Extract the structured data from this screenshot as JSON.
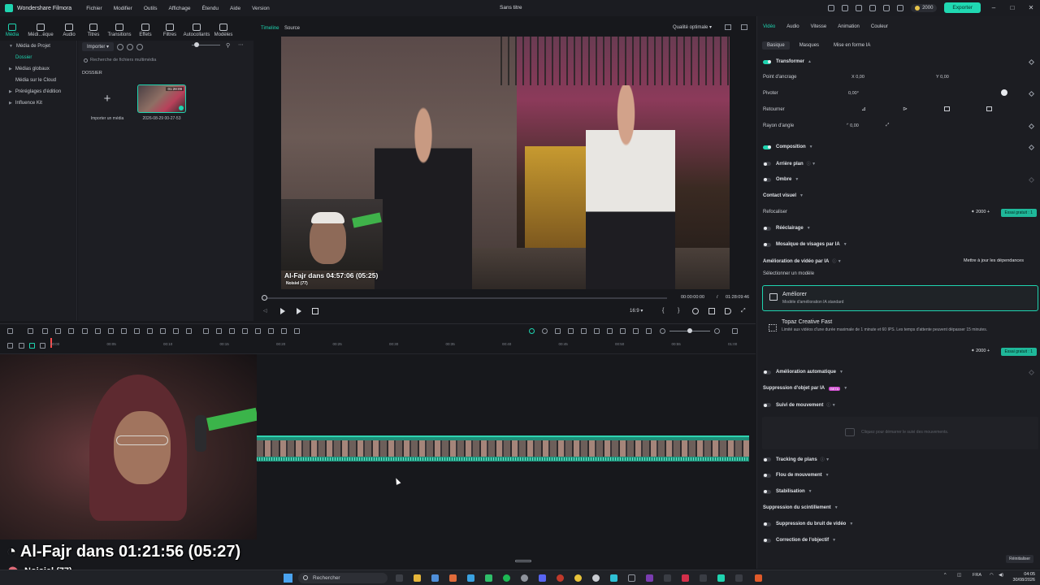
{
  "app": {
    "name": "Wondershare Filmora",
    "project_title": "Sans titre",
    "menu": [
      "Fichier",
      "Modifier",
      "Outils",
      "Affichage",
      "Étendu",
      "Aide",
      "Version"
    ],
    "credits": "2000",
    "export_label": "Exporter"
  },
  "media_tabs": [
    "Média",
    "Médi...èque",
    "Audio",
    "Titres",
    "Transitions",
    "Effets",
    "Filtres",
    "Autocollants",
    "Modèles"
  ],
  "left_nav": {
    "items": [
      {
        "label": "Média de Projet",
        "sub": false,
        "active": false
      },
      {
        "label": "Dossier",
        "sub": true,
        "active": true
      },
      {
        "label": "Médias globaux",
        "sub": false,
        "active": false
      },
      {
        "label": "Média sur le Cloud",
        "sub": false,
        "active": false
      },
      {
        "label": "Préréglages d'édition",
        "sub": false,
        "active": false
      },
      {
        "label": "Influence Kit",
        "sub": false,
        "active": false
      }
    ]
  },
  "media_pane": {
    "import_label": "Importer",
    "search_placeholder": "Recherche de fichiers multimédia",
    "folder_label": "DOSSIER",
    "import_card_label": "Importer un média",
    "clip": {
      "name": "2026-08-29 00-27-53",
      "duration": "01:28:09"
    }
  },
  "preview": {
    "tab_timeline": "Timeline",
    "tab_source": "Source",
    "quality": "Qualité optimale",
    "current_time": "00:00:00:00",
    "total_time": "01:28:09:46",
    "ratio": "16:9",
    "overlay_timer": "Al-Fajr dans 04:57:06 (05:25)",
    "overlay_name": "Noisiel (77)"
  },
  "ruler_ticks": [
    "00:00",
    "00:05",
    "00:10",
    "00:15",
    "00:20",
    "00:25",
    "00:30",
    "00:35",
    "00:40",
    "00:45",
    "00:50",
    "00:55",
    "01:00"
  ],
  "stream_overlay": {
    "timer": "Al-Fajr dans 01:21:56 (05:27)",
    "location": "Noisiel (77)"
  },
  "right_panel": {
    "tabs": [
      "Vidéo",
      "Audio",
      "Vitesse",
      "Animation",
      "Couleur"
    ],
    "subtabs": [
      "Basique",
      "Masques",
      "Mise en forme IA"
    ],
    "transform": "Transformer",
    "anchor_label": "Point d'ancrage",
    "anchor_x": "0,00",
    "anchor_y": "0,00",
    "rotate_label": "Pivoter",
    "rotate_value": "0,00°",
    "flip_label": "Retourner",
    "radius_label": "Rayon d'angle",
    "radius_value": "0,00",
    "composition": "Composition",
    "background": "Arrière plan",
    "shadow": "Ombre",
    "visual_contact": "Contact visuel",
    "refocus": "Refocaliser",
    "credit_value": "2000",
    "trial_label": "Essai gratuit : 1",
    "relight": "Rééclairage",
    "face_mosaic": "Mosaïque de visages par IA",
    "ai_enhance": "Amélioration de vidéo par IA",
    "update_deps": "Mettre à jour les dépendances",
    "select_model": "Sélectionner un modèle",
    "model1_title": "Améliorer",
    "model1_desc": "Modèle d'amélioration IA standard",
    "model2_title": "Topaz Creative Fast",
    "model2_desc": "Limité aux vidéos d'une durée maximale de 1 minute et 60 IPS. Les temps d'attente peuvent dépasser 15 minutes.",
    "auto_enhance": "Amélioration automatique",
    "object_removal": "Suppression d'objet par IA",
    "beta": "BETA",
    "motion_tracking": "Suivi de mouvement",
    "tracker_hint": "Cliquez pour démarrer le suivi des mouvements.",
    "plane_tracking": "Tracking de plans",
    "motion_blur": "Flou de mouvement",
    "stabilization": "Stabilisation",
    "flicker_removal": "Suppression du scintillement",
    "video_denoise": "Suppression du bruit de vidéo",
    "lens_correction": "Correction de l'objectif",
    "reset": "Réinitialiser"
  },
  "taskbar": {
    "search_placeholder": "Rechercher",
    "lang": "FRA",
    "time": "04:05",
    "date": "30/08/2026"
  },
  "colors": {
    "accent": "#1fd4b0",
    "background": "#17181c",
    "panel": "#1c1d22"
  }
}
